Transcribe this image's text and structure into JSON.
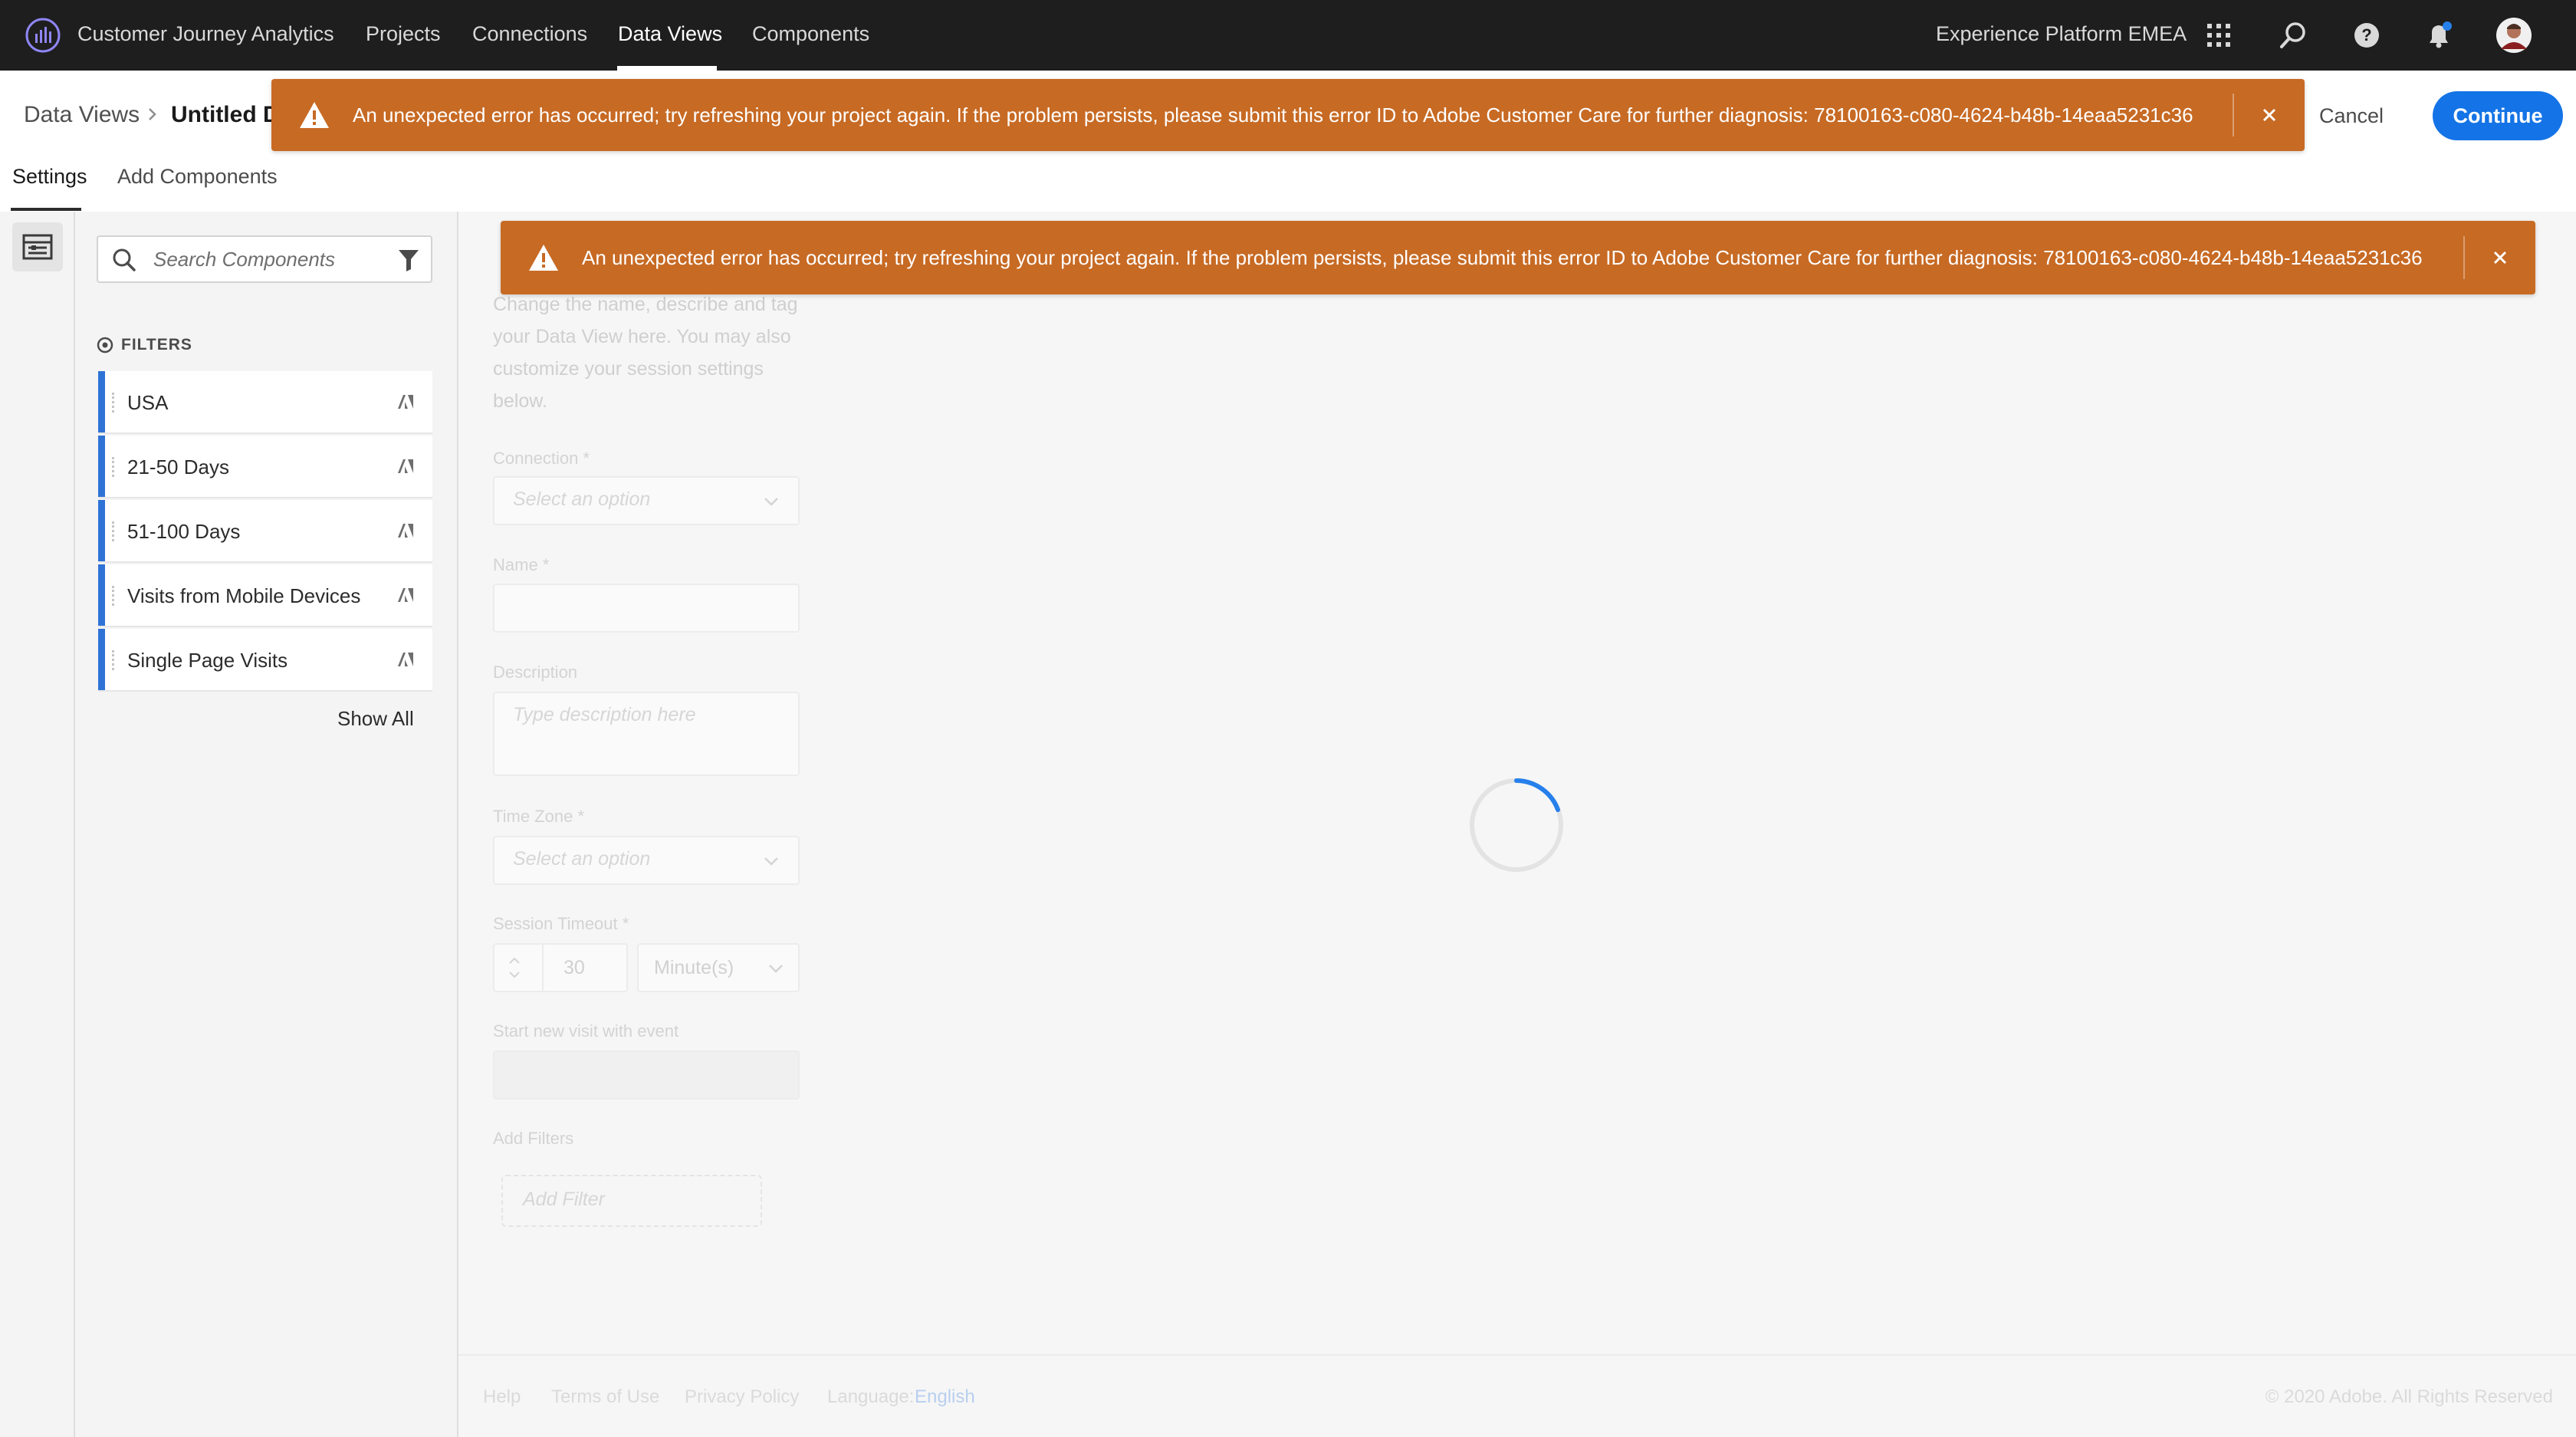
{
  "topnav": {
    "product": "Customer Journey Analytics",
    "items": [
      "Projects",
      "Connections",
      "Data Views",
      "Components"
    ],
    "active": "Data Views",
    "org": "Experience Platform EMEA",
    "icons": [
      "apps-grid-icon",
      "search-icon",
      "help-icon",
      "notification-bell-icon",
      "user-avatar"
    ]
  },
  "breadcrumb": {
    "root": "Data Views",
    "current": "Untitled D"
  },
  "header_buttons": {
    "cancel": "Cancel",
    "continue": "Continue"
  },
  "tabs": [
    "Settings",
    "Add Components"
  ],
  "active_tab": "Settings",
  "error": {
    "message": "An unexpected error has occurred; try refreshing your project again. If the problem persists, please submit this error ID to Adobe Customer Care for further diagnosis: 78100163-c080-4624-b48b-14eaa5231c36",
    "color": "#c76a24"
  },
  "components_panel": {
    "search_placeholder": "Search Components",
    "filters_heading": "FILTERS",
    "filters": [
      "USA",
      "21-50 Days",
      "51-100 Days",
      "Visits from Mobile Devices",
      "Single Page Visits"
    ],
    "show_all": "Show All"
  },
  "settings_form": {
    "intro": "Change the name, describe and tag your Data View here. You may also customize your session settings below.",
    "connection_label": "Connection *",
    "connection_placeholder": "Select an option",
    "name_label": "Name *",
    "description_label": "Description",
    "description_placeholder": "Type description here",
    "timezone_label": "Time Zone *",
    "timezone_placeholder": "Select an option",
    "session_timeout_label": "Session Timeout *",
    "session_timeout_value": "30",
    "session_timeout_unit": "Minute(s)",
    "new_visit_label": "Start new visit with event",
    "add_filters_label": "Add Filters",
    "add_filter_placeholder": "Add Filter"
  },
  "footer": {
    "links": [
      "Help",
      "Terms of Use",
      "Privacy Policy"
    ],
    "language_label": "Language:",
    "language_value": "English",
    "copyright": "© 2020 Adobe. All Rights Reserved"
  },
  "accent_color": "#1473e6"
}
